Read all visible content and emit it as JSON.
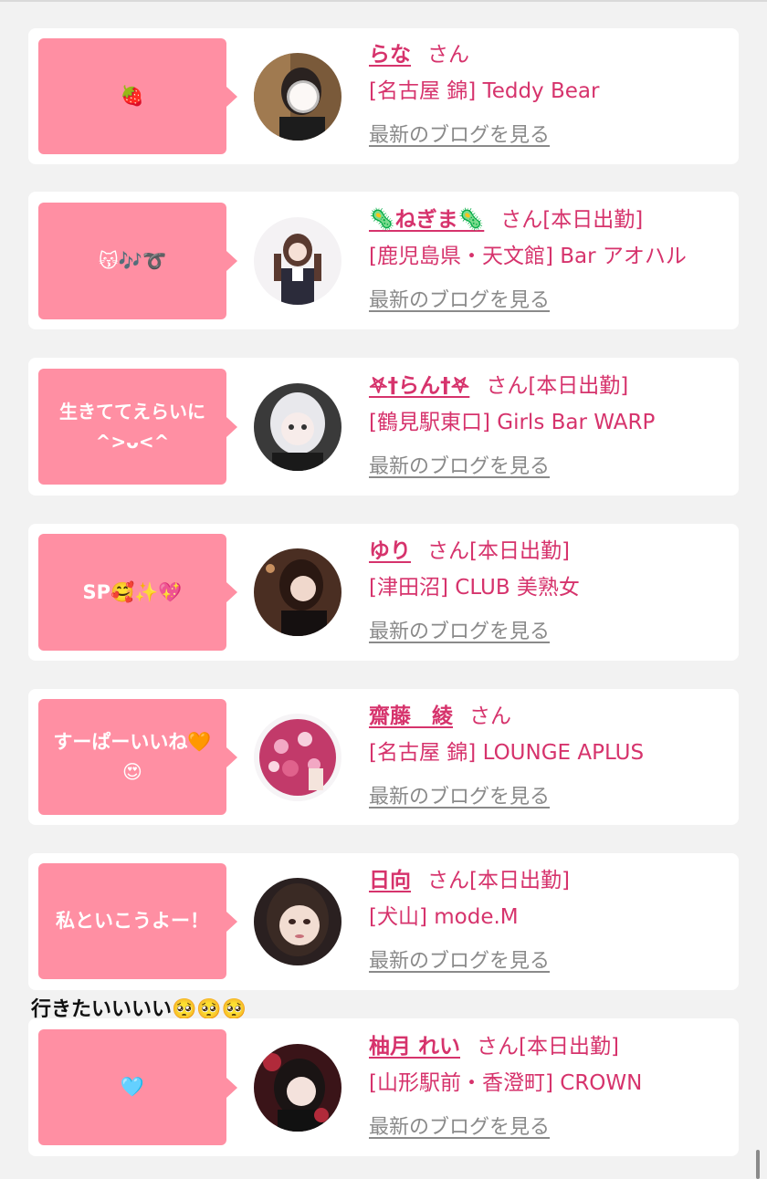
{
  "cards": [
    {
      "bubble": "🍓",
      "name": "らな",
      "san": "さん",
      "status": "",
      "store": "[名古屋 錦] Teddy Bear",
      "blog": "最新のブログを見る",
      "avatar_icon": "avatar-girl-1"
    },
    {
      "bubble": "😽🎶➰",
      "name": "🦠ねぎま🦠",
      "san": "さん",
      "status": "[本日出勤]",
      "store": "[鹿児島県・天文館] Bar アオハル",
      "blog": "最新のブログを見る",
      "avatar_icon": "avatar-girl-2"
    },
    {
      "bubble": "生きててえらいに\n^>ᴗ<^",
      "name": "𖤐†らん†𖤐",
      "san": "さん",
      "status": "[本日出勤]",
      "store": "[鶴見駅東口] Girls Bar WARP",
      "blog": "最新のブログを見る",
      "avatar_icon": "avatar-girl-3"
    },
    {
      "bubble": "SP🥰✨💖",
      "name": "ゆり",
      "san": "さん",
      "status": "[本日出勤]",
      "store": "[津田沼] CLUB 美熟女",
      "blog": "最新のブログを見る",
      "avatar_icon": "avatar-girl-4"
    },
    {
      "bubble": "すーぱーいいね🧡\n😍",
      "name": "齋藤　綾",
      "san": "さん",
      "status": "",
      "store": "[名古屋 錦] LOUNGE APLUS",
      "blog": "最新のブログを見る",
      "avatar_icon": "avatar-girl-5"
    },
    {
      "bubble": "私といこうよー！",
      "name": "日向",
      "san": "さん",
      "status": "[本日出勤]",
      "store": "[犬山] mode.M",
      "blog": "最新のブログを見る",
      "avatar_icon": "avatar-girl-6"
    },
    {
      "bubble": "🩵",
      "name": "柚月 れい",
      "san": "さん",
      "status": "[本日出勤]",
      "store": "[山形駅前・香澄町] CROWN",
      "blog": "最新のブログを見る",
      "avatar_icon": "avatar-girl-7"
    }
  ],
  "user_comment": "行きたいいいい🥺🥺🥺",
  "colors": {
    "accent": "#d6336c",
    "bubble": "#ff8fa3",
    "background": "#f2f2f2",
    "link_gray": "#8a8a8a"
  }
}
